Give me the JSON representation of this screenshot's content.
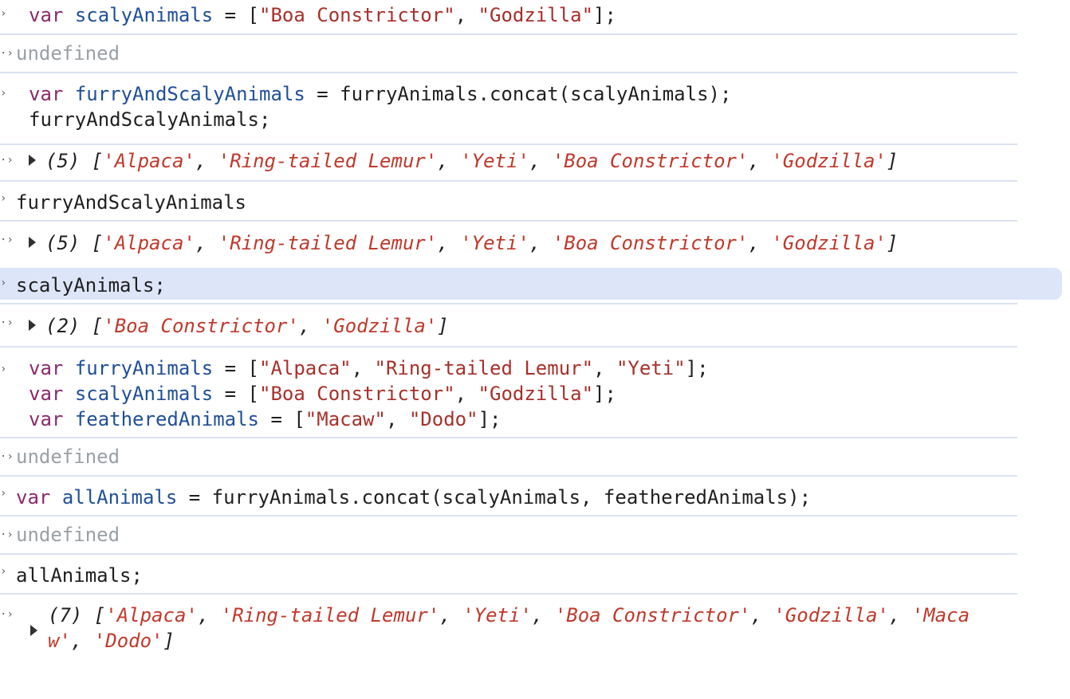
{
  "rows": {
    "r1": {
      "kw": "var",
      "name": "scalyAnimals",
      "eq": " = [",
      "s1": "\"Boa Constrictor\"",
      "c1": ", ",
      "s2": "\"Godzilla\"",
      "end": "];"
    },
    "r2": "undefined",
    "r3": {
      "kw": "var",
      "name": "furryAndScalyAnimals",
      "rest": " = furryAnimals.concat(scalyAnimals);",
      "line2": "furryAndScalyAnimals;"
    },
    "r4": {
      "count": "(5) [",
      "items": [
        "'Alpaca'",
        "'Ring-tailed Lemur'",
        "'Yeti'",
        "'Boa Constrictor'",
        "'Godzilla'"
      ],
      "sep": ", ",
      "close": "]"
    },
    "r5": "furryAndScalyAnimals",
    "r6": {
      "count": "(5) [",
      "items": [
        "'Alpaca'",
        "'Ring-tailed Lemur'",
        "'Yeti'",
        "'Boa Constrictor'",
        "'Godzilla'"
      ],
      "sep": ", ",
      "close": "]"
    },
    "r7": "scalyAnimals;",
    "r8": {
      "count": "(2) [",
      "items": [
        "'Boa Constrictor'",
        "'Godzilla'"
      ],
      "sep": ", ",
      "close": "]"
    },
    "r9": {
      "l1": {
        "kw": "var",
        "name": "furryAnimals",
        "eq": " = [",
        "s": [
          "\"Alpaca\"",
          "\"Ring-tailed Lemur\"",
          "\"Yeti\""
        ],
        "sep": ", ",
        "end": "];"
      },
      "l2": {
        "kw": "var",
        "name": "scalyAnimals",
        "eq": " = [",
        "s": [
          "\"Boa Constrictor\"",
          "\"Godzilla\""
        ],
        "sep": ", ",
        "end": "];"
      },
      "l3": {
        "kw": "var",
        "name": "featheredAnimals",
        "eq": " = [",
        "s": [
          "\"Macaw\"",
          "\"Dodo\""
        ],
        "sep": ", ",
        "end": "];"
      }
    },
    "r10": "undefined",
    "r11": {
      "kw": "var",
      "name": "allAnimals",
      "rest": " = furryAnimals.concat(scalyAnimals, featheredAnimals);"
    },
    "r12": "undefined",
    "r13": "allAnimals;",
    "r14": {
      "count": "(7) [",
      "items": [
        "'Alpaca'",
        "'Ring-tailed Lemur'",
        "'Yeti'",
        "'Boa Constrictor'",
        "'Godzilla'",
        "'Maca",
        "w'",
        "'Dodo'"
      ],
      "sep": ", ",
      "close": "]"
    }
  },
  "icons": {
    "input_prompt": "chevron-right-icon",
    "output_marker": "return-arrow-icon",
    "expand": "expand-triangle-icon"
  }
}
